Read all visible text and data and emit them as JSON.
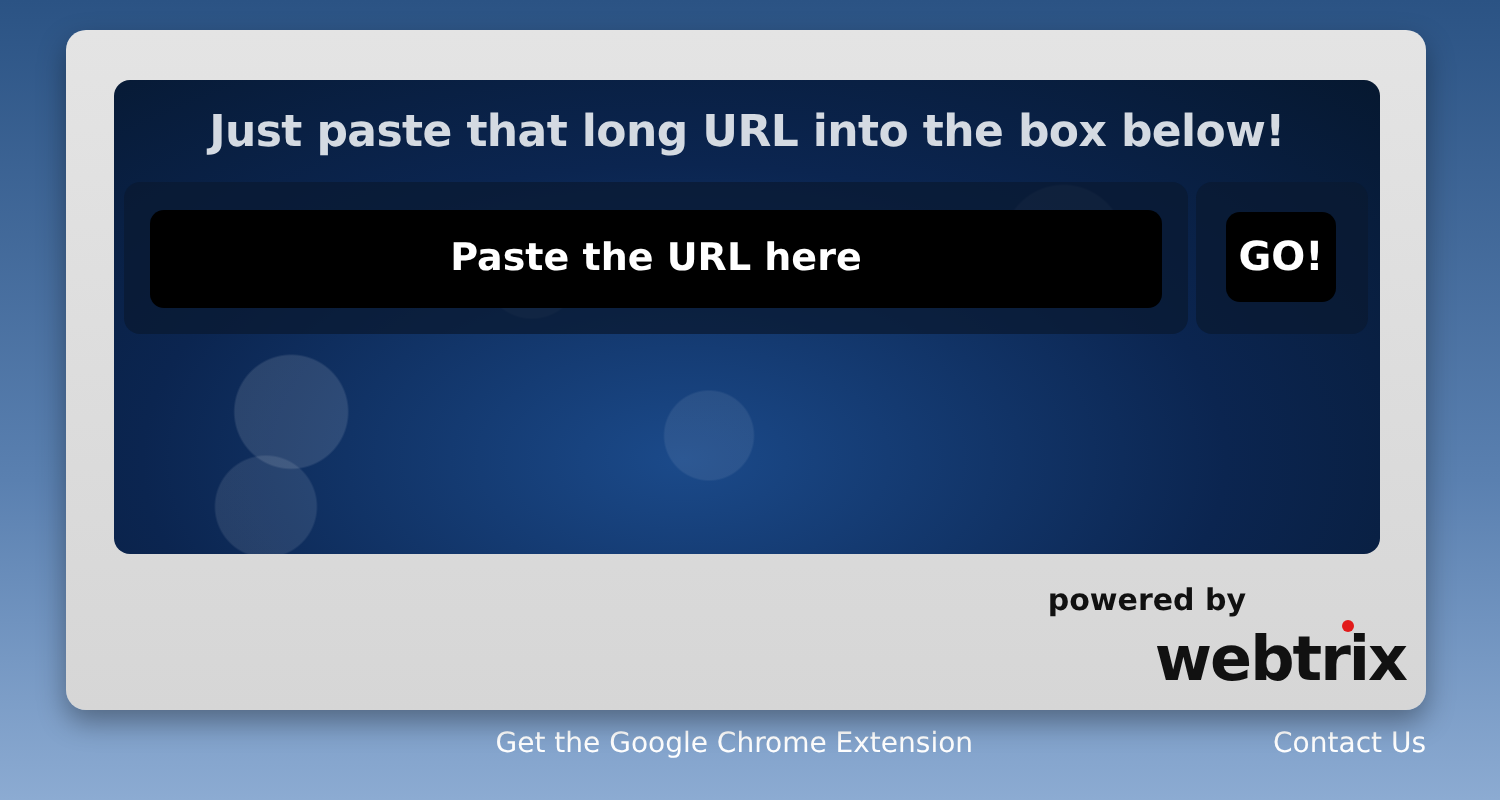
{
  "heading": "Just paste that long URL into the box below!",
  "url_field": {
    "placeholder": "Paste the URL here"
  },
  "go_button": "GO!",
  "powered_by": {
    "caption": "powered by",
    "brand": "webtrix"
  },
  "footer_links": [
    "Get the Google Chrome Extension",
    "Contact Us"
  ]
}
